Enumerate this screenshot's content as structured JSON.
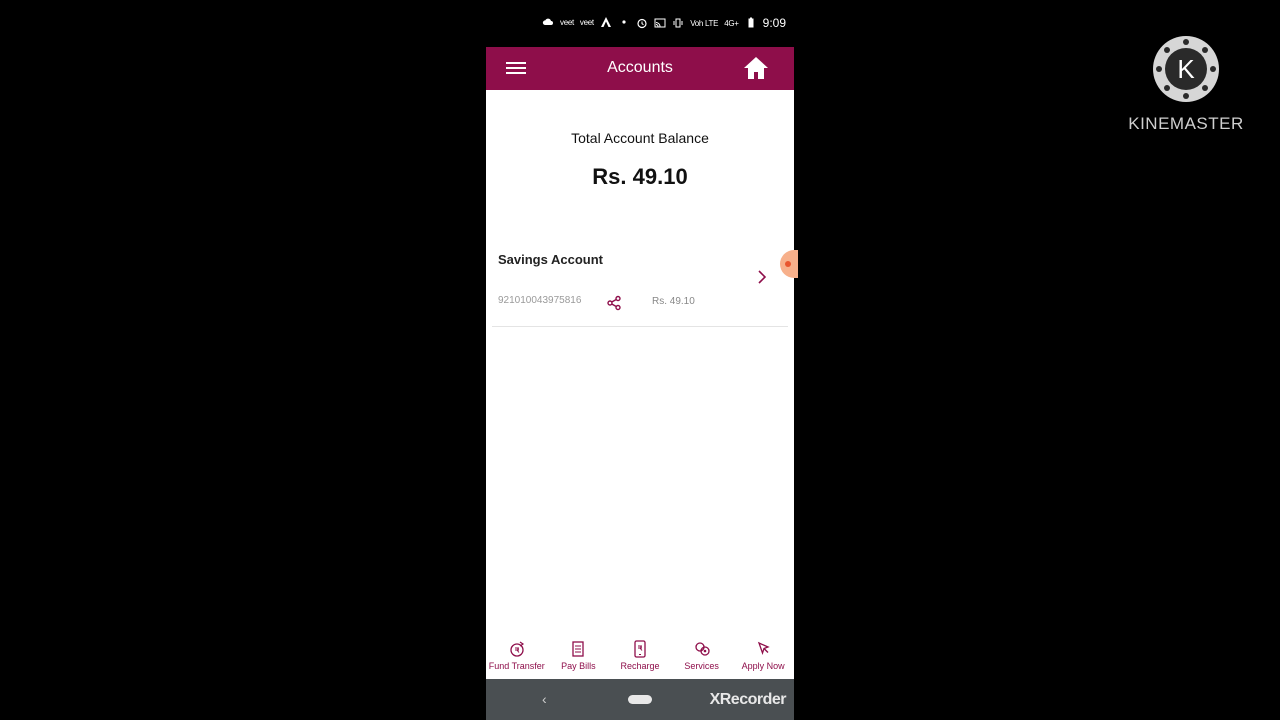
{
  "status_bar": {
    "carrier_1": "veet",
    "carrier_2": "veet",
    "network": "Voh LTE",
    "signal": "4G+",
    "time": "9:09"
  },
  "header": {
    "title": "Accounts",
    "menu_icon": "hamburger-menu-icon",
    "home_icon": "home-icon"
  },
  "summary": {
    "label": "Total Account Balance",
    "value": "Rs. 49.10"
  },
  "accounts": [
    {
      "name": "Savings Account",
      "number": "921010043975816",
      "balance": "Rs. 49.10"
    }
  ],
  "bottom_nav": [
    {
      "label": "Fund Transfer",
      "icon": "fund-transfer-icon"
    },
    {
      "label": "Pay Bills",
      "icon": "pay-bills-icon"
    },
    {
      "label": "Recharge",
      "icon": "recharge-icon"
    },
    {
      "label": "Services",
      "icon": "services-icon"
    },
    {
      "label": "Apply Now",
      "icon": "apply-now-icon"
    }
  ],
  "system_nav": {
    "recorder_label": "XRecorder"
  },
  "watermark": {
    "logo_letter": "K",
    "brand": "KINEMASTER"
  },
  "colors": {
    "brand": "#8e0e4a",
    "background": "#000000",
    "content": "#ffffff"
  }
}
